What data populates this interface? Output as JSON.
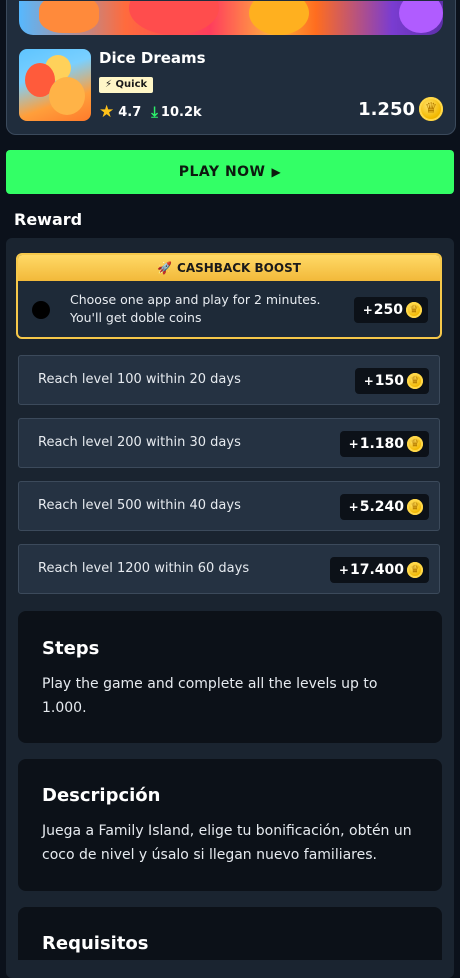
{
  "app": {
    "name": "Dice Dreams",
    "badge": "Quick",
    "rating": "4.7",
    "downloads": "10.2k",
    "price": "1.250"
  },
  "play_button": {
    "label": "PLAY NOW"
  },
  "reward": {
    "title": "Reward",
    "cashback": {
      "header": "CASHBACK BOOST",
      "text_line1": "Choose one app and play for 2 minutes.",
      "text_line2": "You'll get doble coins",
      "plus": "+",
      "amount": "250"
    },
    "levels": [
      {
        "label": "Reach level 100 within 20 days",
        "plus": "+",
        "amount": "150"
      },
      {
        "label": "Reach level 200 within 30 days",
        "plus": "+",
        "amount": "1.180"
      },
      {
        "label": "Reach level 500 within 40 days",
        "plus": "+",
        "amount": "5.240"
      },
      {
        "label": "Reach level 1200 within 60 days",
        "plus": "+",
        "amount": "17.400"
      }
    ]
  },
  "steps": {
    "title": "Steps",
    "text": "Play the game and complete all the levels up to 1.000."
  },
  "description": {
    "title": "Descripción",
    "text": "Juega a Family Island, elige tu bonificación, obtén un coco de nivel y úsalo si llegan nuevo familiares."
  },
  "requirements": {
    "title": "Requisitos"
  },
  "colors": {
    "background": "#0b111b",
    "accent_green": "#33ff66",
    "cashback_gold": "#f6c84a",
    "panel": "#1a2430"
  },
  "icons": [
    "star-icon",
    "download-icon",
    "coin-icon",
    "rocket-icon",
    "play-icon",
    "bolt-icon"
  ]
}
